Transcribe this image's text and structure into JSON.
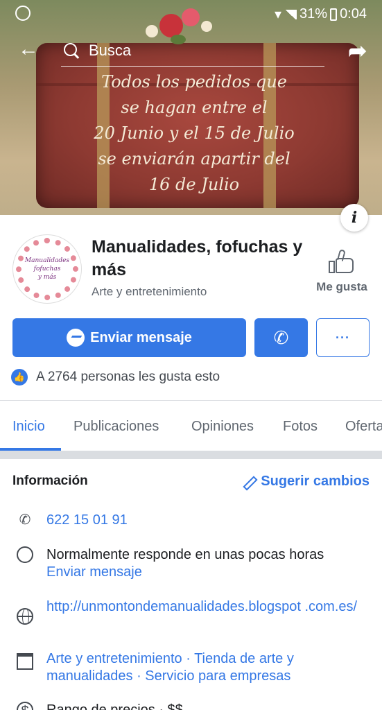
{
  "status_bar": {
    "battery": "31%",
    "time": "0:04"
  },
  "topbar": {
    "search_placeholder": "Busca"
  },
  "cover": {
    "lines": [
      "Todos los pedidos que",
      "se hagan entre el",
      "20 Junio y el 15 de Julio",
      "se enviarán apartir del",
      "16 de Julio"
    ],
    "info_glyph": "i"
  },
  "profile": {
    "avatar_text": [
      "Manualidades",
      "fofuchas",
      "y más"
    ],
    "name": "Manualidades, fofuchas y más",
    "category": "Arte y entretenimiento",
    "like_label": "Me gusta"
  },
  "actions": {
    "message_label": "Enviar mensaje",
    "call_glyph": "✆",
    "more_glyph": "···"
  },
  "likes": {
    "text": "A 2764 personas les gusta esto"
  },
  "tabs": [
    "Inicio",
    "Publicaciones",
    "Opiniones",
    "Fotos",
    "Ofertas"
  ],
  "active_tab": "Inicio",
  "info": {
    "title": "Información",
    "suggest_label": "Sugerir cambios",
    "phone": "622 15 01 91",
    "response_text": "Normalmente responde en unas pocas horas",
    "response_link": "Enviar mensaje",
    "website": "http://unmontondemanualidades.blogspot .com.es/",
    "categories": "Arte y entretenimiento · Tienda de arte y manualidades · Servicio para empresas",
    "price_range": "Rango de precios · $$"
  },
  "colors": {
    "accent": "#3578e5",
    "text_secondary": "#606770"
  }
}
